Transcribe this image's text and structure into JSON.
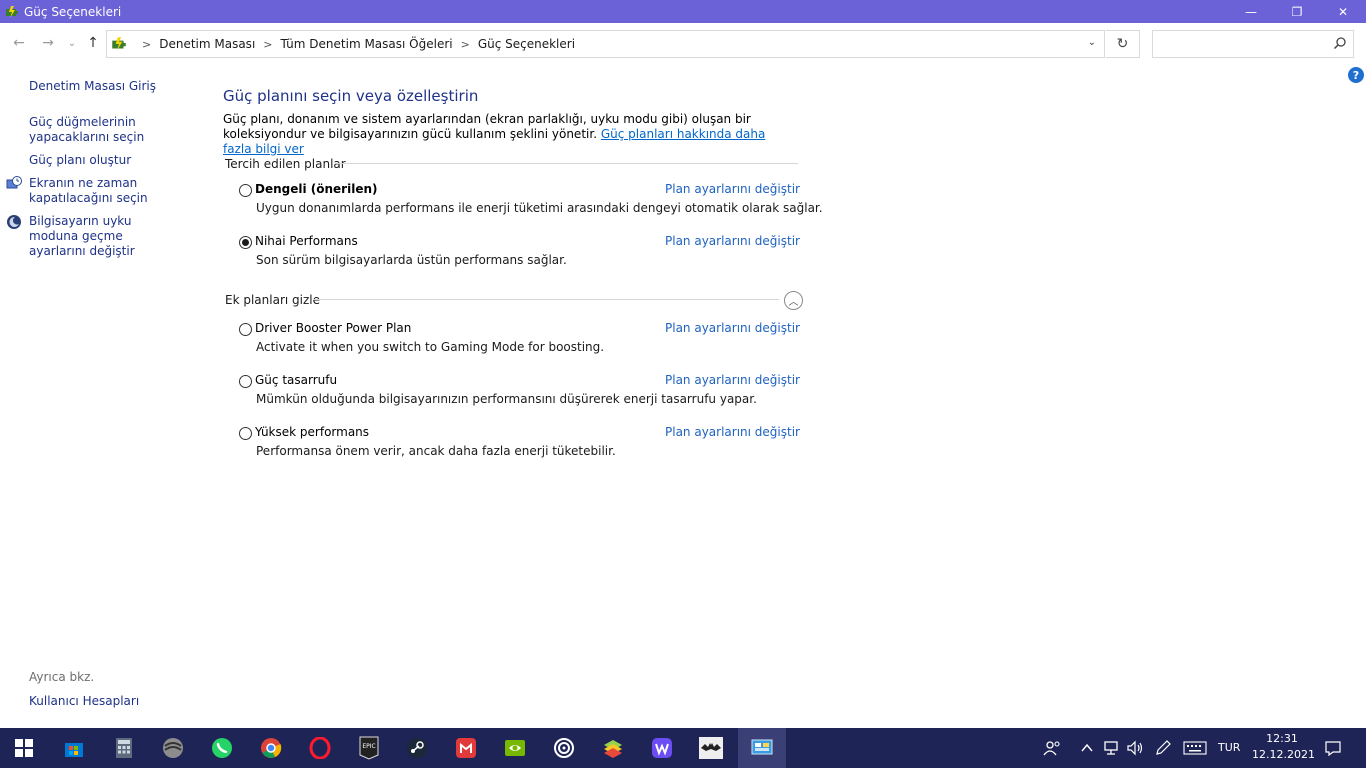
{
  "window": {
    "title": "Güç Seçenekleri",
    "minimize": "—",
    "maximize": "❐",
    "close": "✕"
  },
  "nav": {
    "back": "←",
    "forward": "→",
    "recent": "⌄",
    "up": "↑",
    "breadcrumb": [
      "Denetim Masası",
      "Tüm Denetim Masası Öğeleri",
      "Güç Seçenekleri"
    ],
    "separator": ">",
    "dropdown": "⌄",
    "refresh": "↻",
    "search_placeholder": ""
  },
  "help": "?",
  "sidebar": {
    "items": [
      {
        "label": "Denetim Masası Giriş"
      },
      {
        "label": "Güç düğmelerinin yapacaklarını seçin"
      },
      {
        "label": "Güç planı oluştur"
      },
      {
        "label": "Ekranın ne zaman kapatılacağını seçin"
      },
      {
        "label": "Bilgisayarın uyku moduna geçme ayarlarını değiştir"
      }
    ],
    "see_also": "Ayrıca bkz.",
    "user_accounts": "Kullanıcı Hesapları"
  },
  "main": {
    "heading": "Güç planını seçin veya özelleştirin",
    "description": "Güç planı, donanım ve sistem ayarlarından (ekran parlaklığı, uyku modu gibi) oluşan bir koleksiyondur ve bilgisayarınızın gücü kullanım şeklini yönetir.",
    "description_link": "Güç planları hakkında daha fazla bilgi ver",
    "preferred_group": "Tercih edilen planlar",
    "extra_group": "Ek planları gizle",
    "collapse": "︿",
    "change_link": "Plan ayarlarını değiştir",
    "preferred_plans": [
      {
        "name": "Dengeli (önerilen)",
        "desc": "Uygun donanımlarda performans ile enerji tüketimi arasındaki dengeyi otomatik olarak sağlar.",
        "selected": false
      },
      {
        "name": "Nihai Performans",
        "desc": "Son sürüm bilgisayarlarda üstün performans sağlar.",
        "selected": true
      }
    ],
    "extra_plans": [
      {
        "name": "Driver Booster Power Plan",
        "desc": "Activate it when you switch to Gaming Mode for boosting.",
        "selected": false
      },
      {
        "name": "Güç tasarrufu",
        "desc": "Mümkün olduğunda bilgisayarınızın performansını düşürerek enerji tasarrufu yapar.",
        "selected": false
      },
      {
        "name": "Yüksek performans",
        "desc": "Performansa önem verir, ancak daha fazla enerji tüketebilir.",
        "selected": false
      }
    ]
  },
  "taskbar": {
    "apps": [
      "windows-start",
      "microsoft-store",
      "calculator",
      "pro-app",
      "whatsapp",
      "chrome",
      "opera",
      "epic-games",
      "steam",
      "huawei-app",
      "nvidia",
      "ubisoft",
      "bluestacks",
      "wallpaper-app",
      "batman-app",
      "control-panel"
    ],
    "language": "TUR",
    "time": "12:31",
    "date": "12.12.2021"
  },
  "colors": {
    "titlebar": "#6b62d8",
    "taskbar": "#1f2456",
    "link": "#1e62c0",
    "heading": "#1e3287"
  }
}
